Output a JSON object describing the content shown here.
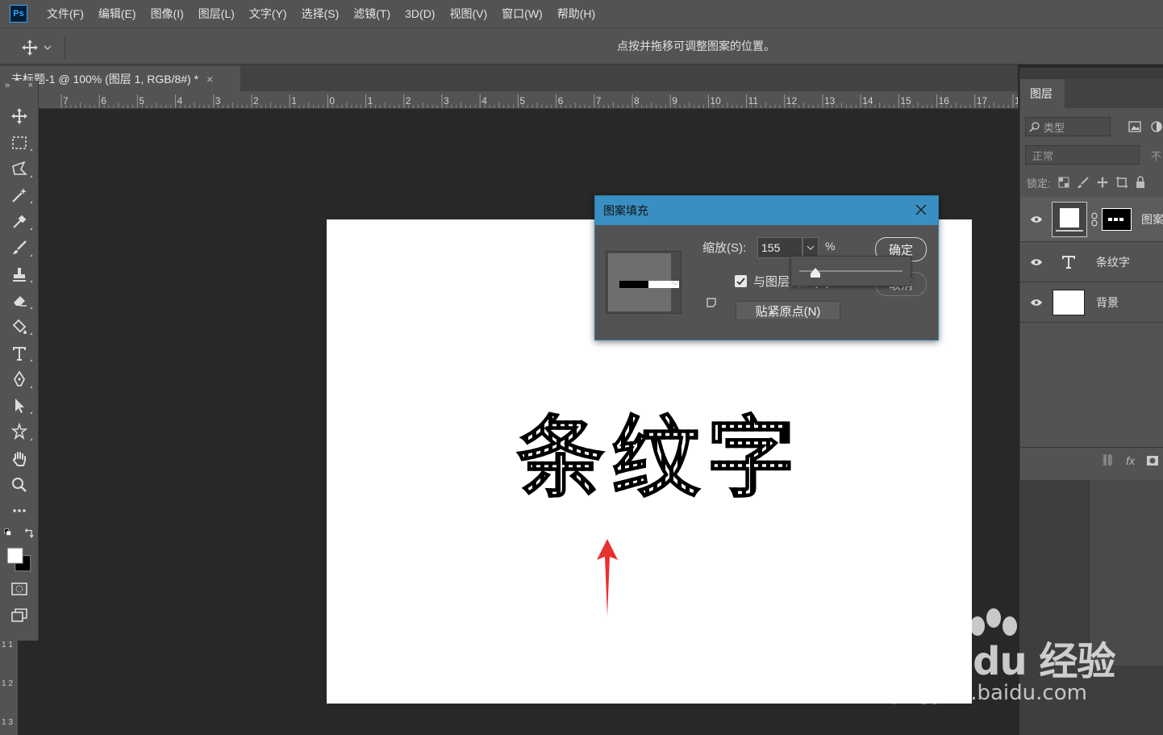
{
  "app": {
    "logo": "Ps"
  },
  "menu": [
    "文件(F)",
    "编辑(E)",
    "图像(I)",
    "图层(L)",
    "文字(Y)",
    "选择(S)",
    "滤镜(T)",
    "3D(D)",
    "视图(V)",
    "窗口(W)",
    "帮助(H)"
  ],
  "options_bar": {
    "hint": "点按并拖移可调整图案的位置。"
  },
  "document": {
    "tab_title": "未标题-1 @ 100% (图层 1, RGB/8#) *",
    "close": "×"
  },
  "ruler": {
    "ticks": [
      "7",
      "6",
      "5",
      "4",
      "3",
      "2",
      "1",
      "0",
      "1",
      "2",
      "3",
      "4",
      "5",
      "6",
      "7",
      "8",
      "9",
      "10",
      "11",
      "12",
      "13",
      "14",
      "15",
      "16",
      "17",
      "1"
    ]
  },
  "ruler_left": {
    "ticks": [
      "1\n1",
      "1\n2",
      "1\n3"
    ]
  },
  "canvas": {
    "text": "条纹字"
  },
  "dialog": {
    "title": "图案填充",
    "scale_label": "缩放(S):",
    "scale_value": "155",
    "percent": "%",
    "ok": "确定",
    "cancel": "取消",
    "link_label": "与图层链接(K)",
    "snap_origin": "贴紧原点(N)",
    "slider_fraction": 0.155
  },
  "layers_panel": {
    "tab": "图层",
    "filter_placeholder": "类型",
    "blend_mode": "正常",
    "opacity_label": "不",
    "lock_label": "锁定:",
    "layers": [
      {
        "name": "图案",
        "visible": true
      },
      {
        "name": "条纹字",
        "visible": true
      },
      {
        "name": "背景",
        "visible": true
      }
    ],
    "footer": {
      "link": "⛓",
      "fx": "fx"
    }
  },
  "watermark": {
    "main": "Bai du 经验",
    "url": "jingyan.baidu.com"
  },
  "colors": {
    "accent": "#3a8fc2",
    "panel": "#535353",
    "canvas_bg": "#282828",
    "arrow": "#e8302e"
  }
}
